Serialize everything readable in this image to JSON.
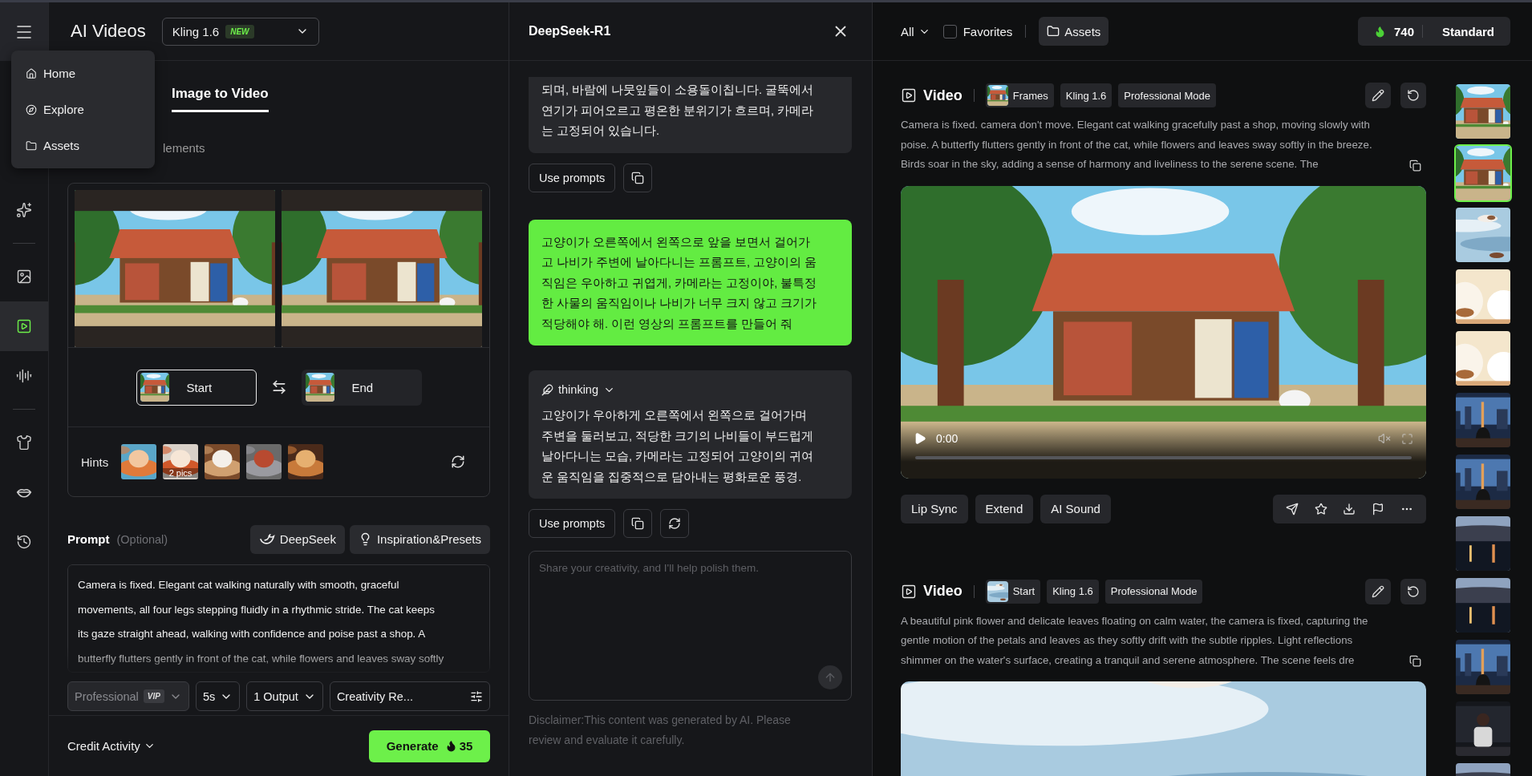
{
  "app_title": "AI Videos",
  "model_select": {
    "value": "Kling 1.6",
    "badge": "NEW"
  },
  "menu": {
    "items": [
      {
        "label": "Home"
      },
      {
        "label": "Explore"
      },
      {
        "label": "Assets"
      }
    ]
  },
  "rail": [
    {
      "selected": false
    },
    {
      "selected": false
    },
    {
      "selected": true
    },
    {
      "selected": false
    },
    {
      "selected": false
    },
    {
      "selected": false
    },
    {
      "selected": false
    }
  ],
  "tabs": [
    {
      "label": "Image to Video",
      "selected": true
    }
  ],
  "elements_tab": {
    "label": "lements"
  },
  "frames": [
    {
      "label": "Start",
      "selected": true
    },
    {
      "label": "End",
      "selected": false
    }
  ],
  "hints": {
    "label": "Hints",
    "items": [
      {
        "kind": "picture"
      },
      {
        "kind": "picture",
        "badge": "2 pics"
      },
      {
        "kind": "picture"
      },
      {
        "kind": "picture"
      },
      {
        "kind": "picture"
      }
    ]
  },
  "prompt": {
    "label": "Prompt",
    "hint": "(Optional)",
    "tools": [
      "DeepSeek",
      "Inspiration&Presets"
    ],
    "value": "Camera is fixed. Elegant cat walking naturally with smooth, graceful\nmovements, all four legs stepping fluidly in a rhythmic stride. The cat keeps\nits gaze straight ahead, walking with confidence and poise past a shop. A\nbutterfly flutters gently in front of the cat, while flowers and leaves sway softly"
  },
  "options": [
    {
      "kind": "select",
      "value": "Professional",
      "badge": "VIP",
      "disabled": true
    },
    {
      "kind": "select",
      "value": "5s",
      "disabled": false
    },
    {
      "kind": "select",
      "value": "1 Output",
      "disabled": false
    },
    {
      "kind": "settings",
      "value": "Creativity Re...",
      "disabled": false
    }
  ],
  "footer": {
    "credit_activity": "Credit Activity",
    "generate": "Generate",
    "cost": "35"
  },
  "assistant": {
    "title": "DeepSeek-R1",
    "messages": [
      {
        "kind": "reply",
        "text": "되며, 바람에 나뭇잎들이 소용돌이칩니다. 굴뚝에서\n연기가 피어오르고 평온한 분위기가 흐르며, 카메라\n는 고정되어 있습니다.",
        "action": "Use prompts",
        "retry": false
      },
      {
        "kind": "user",
        "text": "고양이가 오른쪽에서 왼쪽으로 앞을 보면서 걸어가\n고 나비가 주변에 날아다니는 프롬프트, 고양이의 움\n직임은 우아하고 귀엽게, 카메라는 고정이야, 불특정\n한 사물의 움직임이나 나비가 너무 크지 않고 크기가\n적당해야 해. 이런 영상의 프롬프트를 만들어 줘"
      },
      {
        "kind": "thinking",
        "label": "thinking",
        "text": "고양이가 우아하게 오른쪽에서 왼쪽으로 걸어가며\n주변을 둘러보고, 적당한 크기의 나비들이 부드럽게\n날아다니는 모습, 카메라는 고정되어 고양이의 귀여\n운 움직임을 집중적으로 담아내는 평화로운 풍경.",
        "action": "Use prompts",
        "retry": true
      }
    ],
    "input": {
      "placeholder": "Share your creativity, and I'll help polish them."
    },
    "disclaimer": "Disclaimer:This content was generated by AI. Please\nreview and evaluate it carefully."
  },
  "filter": {
    "label": "All"
  },
  "favorites": {
    "label": "Favorites",
    "checked": false
  },
  "assets_button": "Assets",
  "credits": {
    "count": "740",
    "plan": "Standard"
  },
  "cards": [
    {
      "title": "Video",
      "tags": [
        {
          "kind": "frame",
          "label": "Frames"
        },
        {
          "kind": "text",
          "label": "Kling 1.6"
        },
        {
          "kind": "text",
          "label": "Professional Mode"
        }
      ],
      "text": "Camera is fixed. camera don't move. Elegant cat walking gracefully past a shop, moving slowly with\npoise. A butterfly flutters gently in front of the cat, while flowers and leaves sway softly in the breeze.\nBirds soar in the sky, adding a sense of harmony and liveliness to the serene scene. The",
      "video": {
        "time": "0:00",
        "level": 0
      },
      "actions": [
        "Lip Sync",
        "Extend",
        "AI Sound"
      ]
    },
    {
      "title": "Video",
      "tags": [
        {
          "kind": "frame",
          "label": "Start"
        },
        {
          "kind": "text",
          "label": "Kling 1.6"
        },
        {
          "kind": "text",
          "label": "Professional Mode"
        }
      ],
      "text": "A beautiful pink flower and delicate leaves floating on calm water, the camera is fixed, capturing the\ngentle motion of the petals and leaves as they softly drift with the subtle ripples. Light reflections\nshimmer on the water's surface, creating a tranquil and serene atmosphere. The scene feels dre"
    }
  ],
  "thumbnails": [
    {
      "selected": false
    },
    {
      "selected": true
    },
    {
      "selected": false
    },
    {
      "selected": false
    },
    {
      "selected": false
    },
    {
      "selected": false
    },
    {
      "selected": false
    },
    {
      "selected": false
    },
    {
      "selected": false
    },
    {
      "selected": false
    },
    {
      "selected": false
    },
    {
      "selected": false
    }
  ]
}
